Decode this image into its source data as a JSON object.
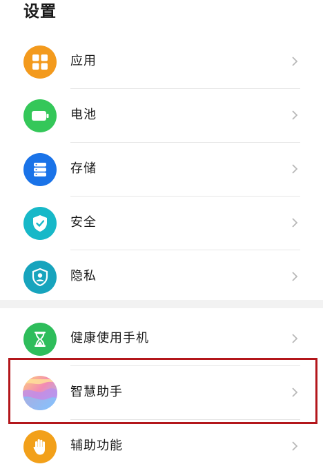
{
  "page": {
    "title": "设置"
  },
  "colors": {
    "apps": "#f39a1d",
    "battery": "#34c759",
    "storage": "#1a73e8",
    "security": "#17b8c8",
    "privacy": "#17a4bd",
    "health": "#2ebd5b",
    "assist": "#f2a01a",
    "highlight": "#b3161b"
  },
  "section1": {
    "items": [
      {
        "label": "应用",
        "icon": "apps-grid-icon"
      },
      {
        "label": "电池",
        "icon": "battery-icon"
      },
      {
        "label": "存储",
        "icon": "storage-icon"
      },
      {
        "label": "安全",
        "icon": "shield-check-icon"
      },
      {
        "label": "隐私",
        "icon": "privacy-shield-icon"
      }
    ]
  },
  "section2": {
    "items": [
      {
        "label": "健康使用手机",
        "icon": "hourglass-icon"
      },
      {
        "label": "智慧助手",
        "icon": "smart-assistant-icon",
        "highlighted": true
      },
      {
        "label": "辅助功能",
        "icon": "hand-icon"
      }
    ]
  }
}
